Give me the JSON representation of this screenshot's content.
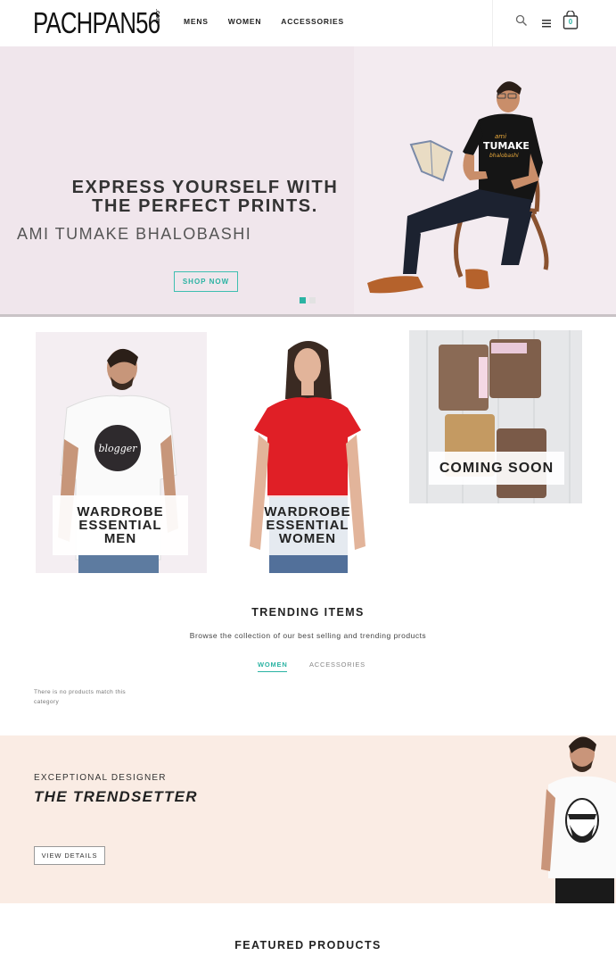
{
  "header": {
    "logo": "PACHPAN56",
    "logo_suffix": ".com",
    "nav": [
      "MENS",
      "WOMEN",
      "ACCESSORIES"
    ],
    "cart_count": "0",
    "icons": [
      "search-icon",
      "menu-icon",
      "bag-icon"
    ]
  },
  "hero": {
    "title_line1": "EXPRESS YOURSELF WITH",
    "title_line2": "THE PERFECT PRINTS.",
    "subtitle": "AMI TUMAKE BHALOBASHI",
    "button": "SHOP NOW",
    "shirt_print_line1": "ami",
    "shirt_print_line2": "TUMAKE",
    "shirt_print_line3": "bhalobashi",
    "slides": 2,
    "active_slide": 1
  },
  "categories": [
    {
      "line1": "WARDROBE",
      "line2": "ESSENTIAL",
      "line3": "MEN",
      "shirt_print": "blogger"
    },
    {
      "line1": "WARDROBE",
      "line2": "ESSENTIAL",
      "line3": "WOMEN"
    },
    {
      "label": "COMING SOON"
    }
  ],
  "trending": {
    "title": "TRENDING ITEMS",
    "subtitle": "Browse the collection of our best selling and trending products",
    "tabs": [
      "WOMEN",
      "ACCESSORIES"
    ],
    "active_tab": "WOMEN",
    "empty_message": "There is no products match this category"
  },
  "trendsetter": {
    "kicker": "EXCEPTIONAL DESIGNER",
    "title": "THE TRENDSETTER",
    "button": "VIEW DETAILS"
  },
  "featured": {
    "title": "FEATURED PRODUCTS"
  },
  "colors": {
    "accent": "#2bb3a3",
    "hero_bg": "#f0e6ec",
    "trendsetter_bg": "#faece4"
  }
}
